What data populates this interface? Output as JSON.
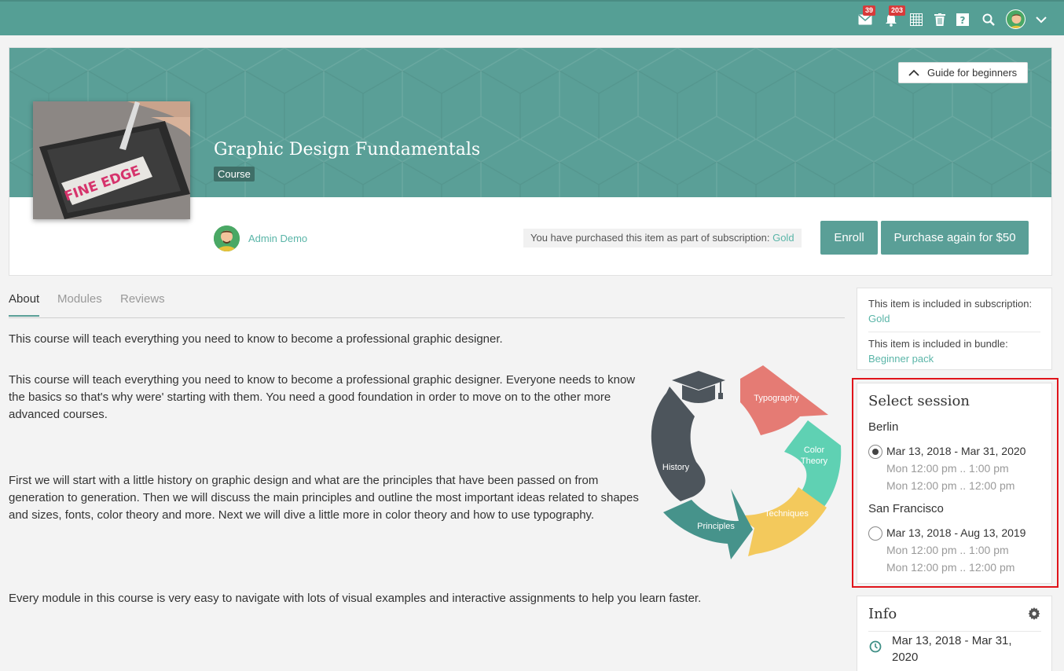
{
  "topbar": {
    "messages_count": "39",
    "notifications_count": "203"
  },
  "hero": {
    "guide_label": "Guide for beginners",
    "title": "Graphic Design Fundamentals",
    "tag": "Course",
    "author": "Admin Demo",
    "subscription_note": "You have purchased this item as part of subscription: ",
    "subscription_name": "Gold",
    "enroll_label": "Enroll",
    "purchase_label": "Purchase again for $50",
    "thumbnail_logo": "FINE EDGE"
  },
  "tabs": [
    "About",
    "Modules",
    "Reviews"
  ],
  "about": {
    "p1": "This course will teach everything you need to know to become a professional graphic designer.",
    "p2": "This course will teach everything you need to know to become a professional graphic designer. Everyone needs to know the basics so that's why were' starting with them. You need a good foundation in order to move on to the other more advanced courses.",
    "p3": "First we will start with a little history on graphic design and what are the principles that have been passed on from generation to generation. Then we will discuss the main principles and outline the most important ideas related to shapes and sizes, fonts, color theory and more. Next we will dive a little more in color theory and how to use typography.",
    "p4": "Every module in this course is very easy to navigate with lots of visual examples and interactive assignments to help you learn faster."
  },
  "diagram": {
    "labels": [
      "Typography",
      "Color",
      "Theory",
      "Techniques",
      "Principles",
      "History"
    ],
    "colors": [
      "#e57b74",
      "#5fd1b3",
      "#f3c95c",
      "#46938b",
      "#4d555c"
    ]
  },
  "sidebar": {
    "included_sub_text": "This item is included in subscription: ",
    "included_sub_link": "Gold",
    "included_bundle_text": "This item is included in bundle: ",
    "included_bundle_link": "Beginner pack",
    "session_title": "Select session",
    "sessions": [
      {
        "city": "Berlin",
        "range": "Mar 13, 2018 - Mar 31, 2020",
        "time1": "Mon 12:00 pm .. 1:00 pm",
        "time2": "Mon 12:00 pm .. 12:00 pm",
        "selected": true
      },
      {
        "city": "San Francisco",
        "range": "Mar 13, 2018 - Aug 13, 2019",
        "time1": "Mon 12:00 pm .. 1:00 pm",
        "time2": "Mon 12:00 pm .. 12:00 pm",
        "selected": false
      }
    ],
    "info_title": "Info",
    "info_date": "Mar 13, 2018 - Mar 31, 2020"
  },
  "colors": {
    "accent": "#5a9f97",
    "link": "#5ab5a8",
    "highlight": "#e0141b"
  }
}
